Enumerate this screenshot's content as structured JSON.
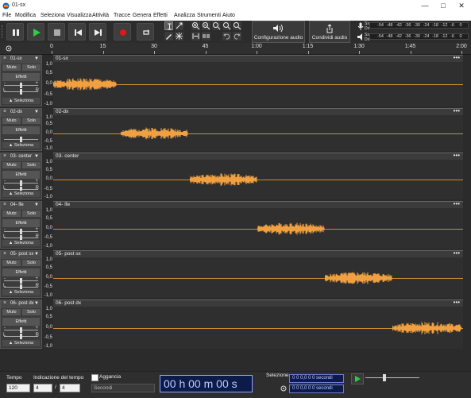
{
  "window": {
    "title": "01-sx",
    "controls": [
      "minimize-icon",
      "maximize-icon",
      "close-icon"
    ]
  },
  "menu": [
    "File",
    "Modifica",
    "Seleziona",
    "Visualizza",
    "Attività",
    "Tracce",
    "Genera",
    "Effetti",
    "Analizza",
    "Strumenti",
    "Aiuto"
  ],
  "toolbar": {
    "transport": [
      "pause-icon",
      "play-icon",
      "stop-icon",
      "skip-start-icon",
      "skip-end-icon",
      "record-icon",
      "loop-icon"
    ],
    "audio_setup_label": "Configurazione audio",
    "share_label": "Condividi audio"
  },
  "meter": {
    "ticks": [
      "-54",
      "-48",
      "-42",
      "-36",
      "-30",
      "-24",
      "-18",
      "-12",
      "-6",
      "0"
    ],
    "rec_channels": [
      "Sx",
      "Dx"
    ],
    "play_channels": [
      "Sx",
      "Dx"
    ]
  },
  "timeline": {
    "labels": [
      "0",
      "15",
      "30",
      "45",
      "1:00",
      "1:15",
      "1:30",
      "1:45",
      "2:00"
    ]
  },
  "track_common": {
    "mute": "Muto",
    "solo": "Solo",
    "effects": "Effetti",
    "select": "Seleziona",
    "scale_top": "1,0",
    "scale_upper": "0,5",
    "scale_zero": "0,0",
    "scale_lower": "-0,5",
    "scale_bottom": "-1,0",
    "gain_minus": "-",
    "gain_plus": "+",
    "pan_left": "L",
    "pan_right": "R",
    "clip_menu": "•••"
  },
  "tracks": [
    {
      "name": "01-sx",
      "clip": "01-sx",
      "audio_start": 0,
      "audio_end": 0.155
    },
    {
      "name": "02-dx",
      "clip": "02-dx",
      "audio_start": 0.165,
      "audio_end": 0.33
    },
    {
      "name": "03- center",
      "clip": "03- center",
      "audio_start": 0.335,
      "audio_end": 0.5
    },
    {
      "name": "04- lfe",
      "clip": "04- lfe",
      "audio_start": 0.5,
      "audio_end": 0.665
    },
    {
      "name": "05- post sx",
      "clip": "05- post sx",
      "audio_start": 0.665,
      "audio_end": 0.83
    },
    {
      "name": "06- post dx",
      "clip": "06- post dx",
      "audio_start": 0.83,
      "audio_end": 1.0
    }
  ],
  "colors": {
    "waveform": "#f0a040",
    "background": "#2b2b2b",
    "record": "#e01818",
    "play": "#2ecc40"
  },
  "bottom": {
    "tempo_label": "Tempo",
    "tempo_value": "120",
    "timesig_label": "Indicazione del tempo",
    "timesig_num": "4",
    "timesig_sep": "/",
    "timesig_den": "4",
    "snap_label": "Aggancia",
    "snap_unit": "Secondi",
    "time_display": "00 h 00 m 00 s",
    "selection_label": "Selezione",
    "sel_start": "0 0 0,0 0 0 secondi",
    "sel_end": "0 0 0,0 0 0 secondi"
  }
}
